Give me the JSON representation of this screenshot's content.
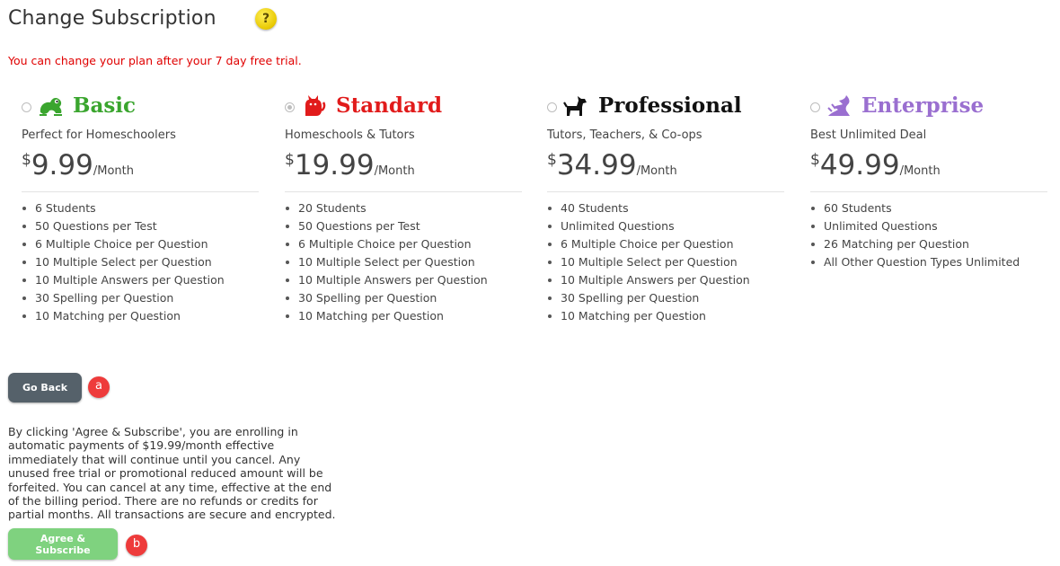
{
  "page": {
    "title": "Change Subscription",
    "help_icon": "question-mark-icon",
    "help_label": "?",
    "trial_notice": "You can change your plan after your 7 day free trial."
  },
  "plans": [
    {
      "name": "Basic",
      "icon": "frog-icon",
      "color": "#3aa52e",
      "selected": false,
      "subtitle": "Perfect for Homeschoolers",
      "currency": "$",
      "price": "9.99",
      "period": "/Month",
      "features": [
        "6 Students",
        "50 Questions per Test",
        "6 Multiple Choice per Question",
        "10 Multiple Select per Question",
        "10 Multiple Answers per Question",
        "30 Spelling per Question",
        "10 Matching per Question"
      ]
    },
    {
      "name": "Standard",
      "icon": "cat-icon",
      "color": "#e11b1b",
      "selected": true,
      "subtitle": "Homeschools & Tutors",
      "currency": "$",
      "price": "19.99",
      "period": "/Month",
      "features": [
        "20 Students",
        "50 Questions per Test",
        "6 Multiple Choice per Question",
        "10 Multiple Select per Question",
        "10 Multiple Answers per Question",
        "30 Spelling per Question",
        "10 Matching per Question"
      ]
    },
    {
      "name": "Professional",
      "icon": "dog-icon",
      "color": "#111111",
      "selected": false,
      "subtitle": "Tutors, Teachers, & Co-ops",
      "currency": "$",
      "price": "34.99",
      "period": "/Month",
      "features": [
        "40 Students",
        "Unlimited Questions",
        "6 Multiple Choice per Question",
        "10 Multiple Select per Question",
        "10 Multiple Answers per Question",
        "30 Spelling per Question",
        "10 Matching per Question"
      ]
    },
    {
      "name": "Enterprise",
      "icon": "dragon-icon",
      "color": "#9a6fd0",
      "selected": false,
      "subtitle": "Best Unlimited Deal",
      "currency": "$",
      "price": "49.99",
      "period": "/Month",
      "features": [
        "60 Students",
        "Unlimited Questions",
        "26 Matching per Question",
        "All Other Question Types Unlimited"
      ]
    }
  ],
  "actions": {
    "back_label": "Go Back",
    "back_marker": "a",
    "terms": "By clicking 'Agree & Subscribe', you are enrolling in automatic payments of $19.99/month effective immediately that will continue until you cancel. Any unused free trial or promotional reduced amount will be forfeited. You can cancel at any time, effective at the end of the billing period. There are no refunds or credits for partial months. All transactions are secure and encrypted.",
    "agree_label": "Agree & Subscribe",
    "agree_marker": "b"
  }
}
